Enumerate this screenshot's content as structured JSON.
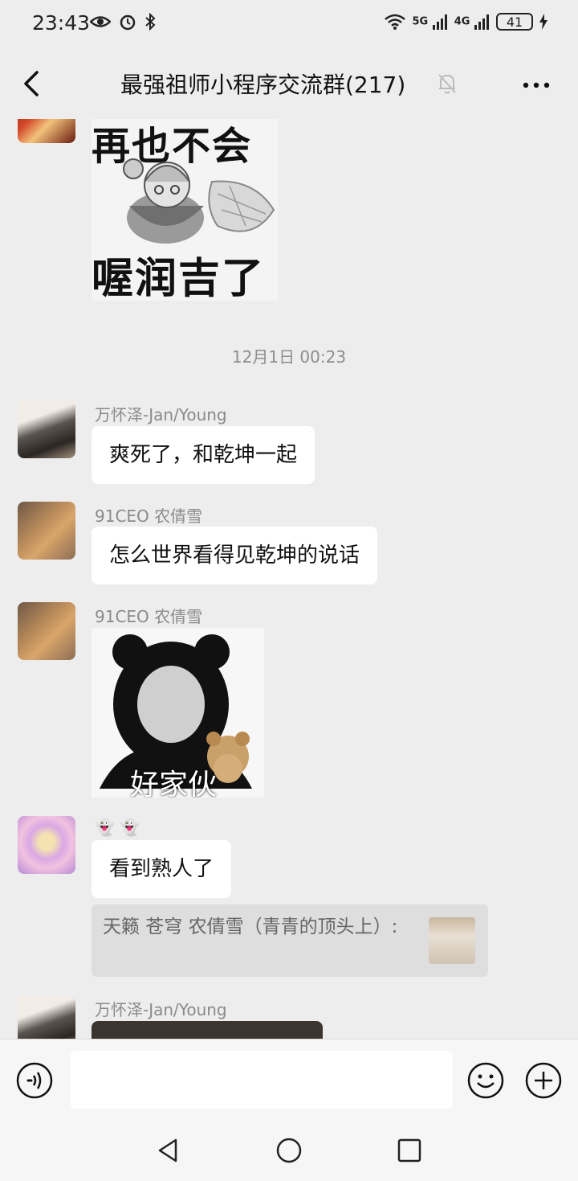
{
  "status_bar": {
    "time": "23:43",
    "signal_1": "5G",
    "signal_2": "4G",
    "battery": "41"
  },
  "header": {
    "title": "最强祖师小程序交流群(217)",
    "icons": [
      "back-arrow-icon",
      "mute-bell-icon",
      "more-icon"
    ]
  },
  "messages": {
    "sticker_top": {
      "line1": "再也不会",
      "line2": "喔润吉了"
    },
    "timestamp": "12月1日 00:23",
    "msg1": {
      "sender": "万怀泽-Jan/Young",
      "text": "爽死了，和乾坤一起"
    },
    "msg2": {
      "sender": "91CEO 农倩雪",
      "text": "怎么世界看得见乾坤的说话"
    },
    "msg3": {
      "sender": "91CEO 农倩雪",
      "sticker_caption": "好家伙"
    },
    "msg4": {
      "sender": "👻 👻",
      "text": "看到熟人了",
      "quote": "天籁 苍穹 农倩雪（青青的顶头上）:"
    },
    "msg5": {
      "sender": "万怀泽-Jan/Young"
    }
  },
  "input_bar": {
    "placeholder": "",
    "icons": [
      "voice-icon",
      "emoji-icon",
      "plus-icon"
    ]
  },
  "colors": {
    "background": "#ededed",
    "bubble": "#ffffff",
    "nickname": "#8a8a8a"
  }
}
